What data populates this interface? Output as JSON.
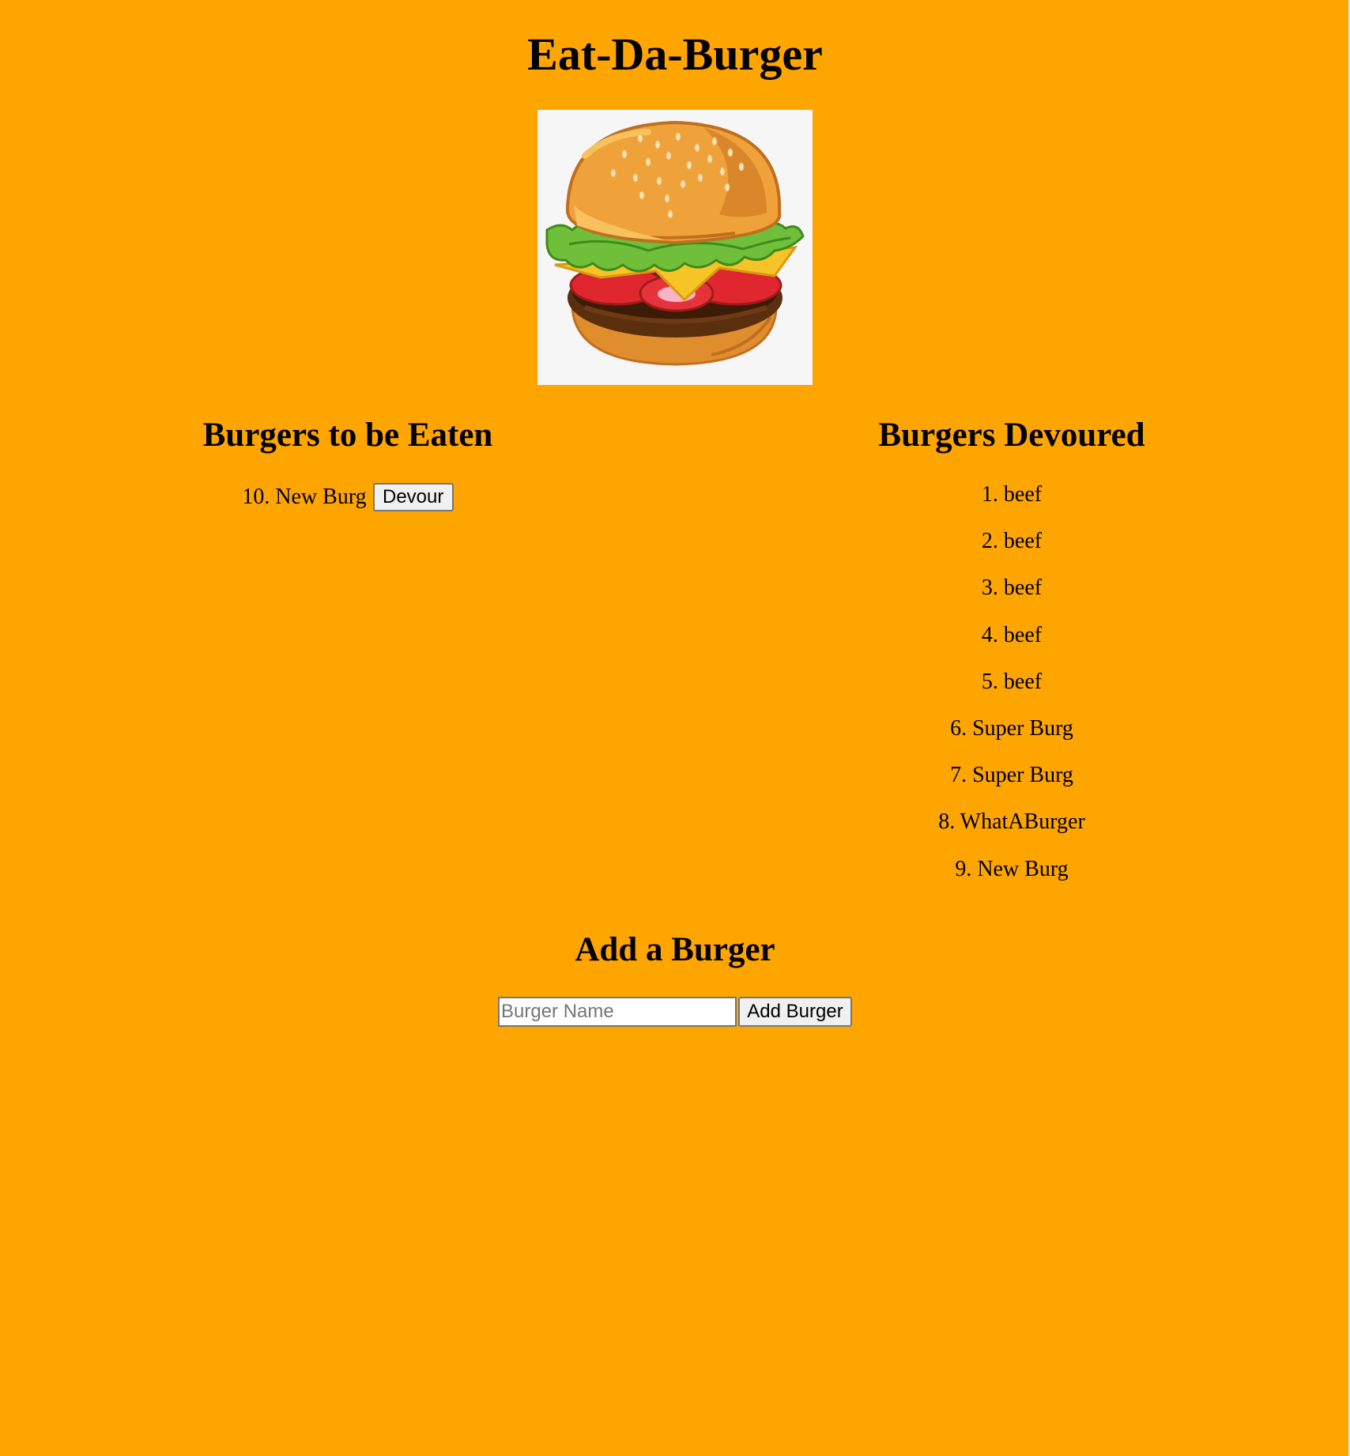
{
  "page": {
    "title": "Eat-Da-Burger"
  },
  "hero": {
    "icon": "burger-illustration"
  },
  "to_eat": {
    "title": "Burgers to be Eaten",
    "items": [
      {
        "text": "10. New Burg",
        "button_label": "Devour"
      }
    ]
  },
  "devoured": {
    "title": "Burgers Devoured",
    "items": [
      "1. beef",
      "2. beef",
      "3. beef",
      "4. beef",
      "5. beef",
      "6. Super Burg",
      "7. Super Burg",
      "8. WhatABurger",
      "9. New Burg"
    ]
  },
  "add_form": {
    "title": "Add a Burger",
    "input_placeholder": "Burger Name",
    "input_value": "",
    "button_label": "Add Burger"
  },
  "colors": {
    "background": "#FFA500"
  }
}
